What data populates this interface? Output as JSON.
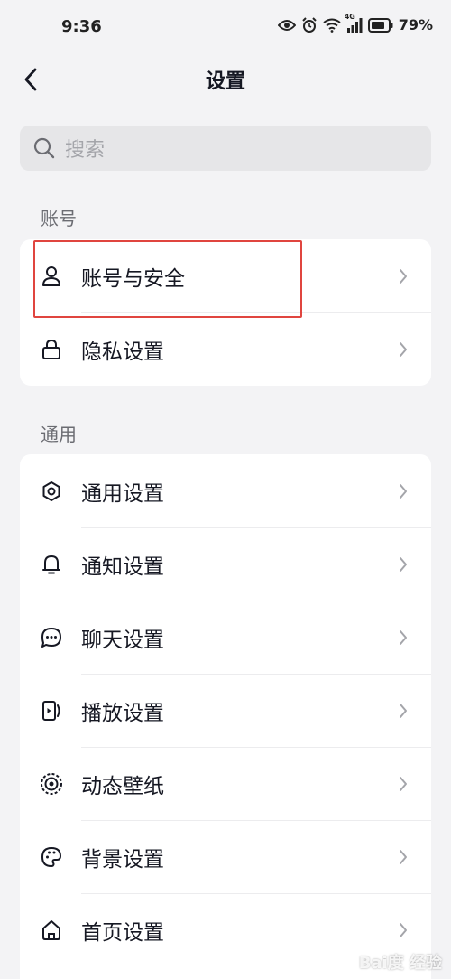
{
  "status_bar": {
    "time": "9:36",
    "network_label": "4G",
    "battery_percent": "79%"
  },
  "header": {
    "title": "设置"
  },
  "search": {
    "placeholder": "搜索"
  },
  "sections": {
    "account": {
      "label": "账号",
      "items": [
        {
          "label": "账号与安全",
          "icon": "user-icon"
        },
        {
          "label": "隐私设置",
          "icon": "lock-icon"
        }
      ]
    },
    "general": {
      "label": "通用",
      "items": [
        {
          "label": "通用设置",
          "icon": "gear-icon"
        },
        {
          "label": "通知设置",
          "icon": "bell-icon"
        },
        {
          "label": "聊天设置",
          "icon": "chat-bubble-icon"
        },
        {
          "label": "播放设置",
          "icon": "play-device-icon"
        },
        {
          "label": "动态壁纸",
          "icon": "live-wallpaper-icon"
        },
        {
          "label": "背景设置",
          "icon": "palette-icon"
        },
        {
          "label": "首页设置",
          "icon": "home-icon"
        }
      ]
    }
  },
  "watermark": {
    "text": "Bai度 经验"
  },
  "colors": {
    "background": "#f3f3f5",
    "card": "#ffffff",
    "search_bg": "#e6e6e8",
    "text_primary": "#161823",
    "text_secondary": "#6b6c72",
    "highlight": "#e0453f"
  }
}
